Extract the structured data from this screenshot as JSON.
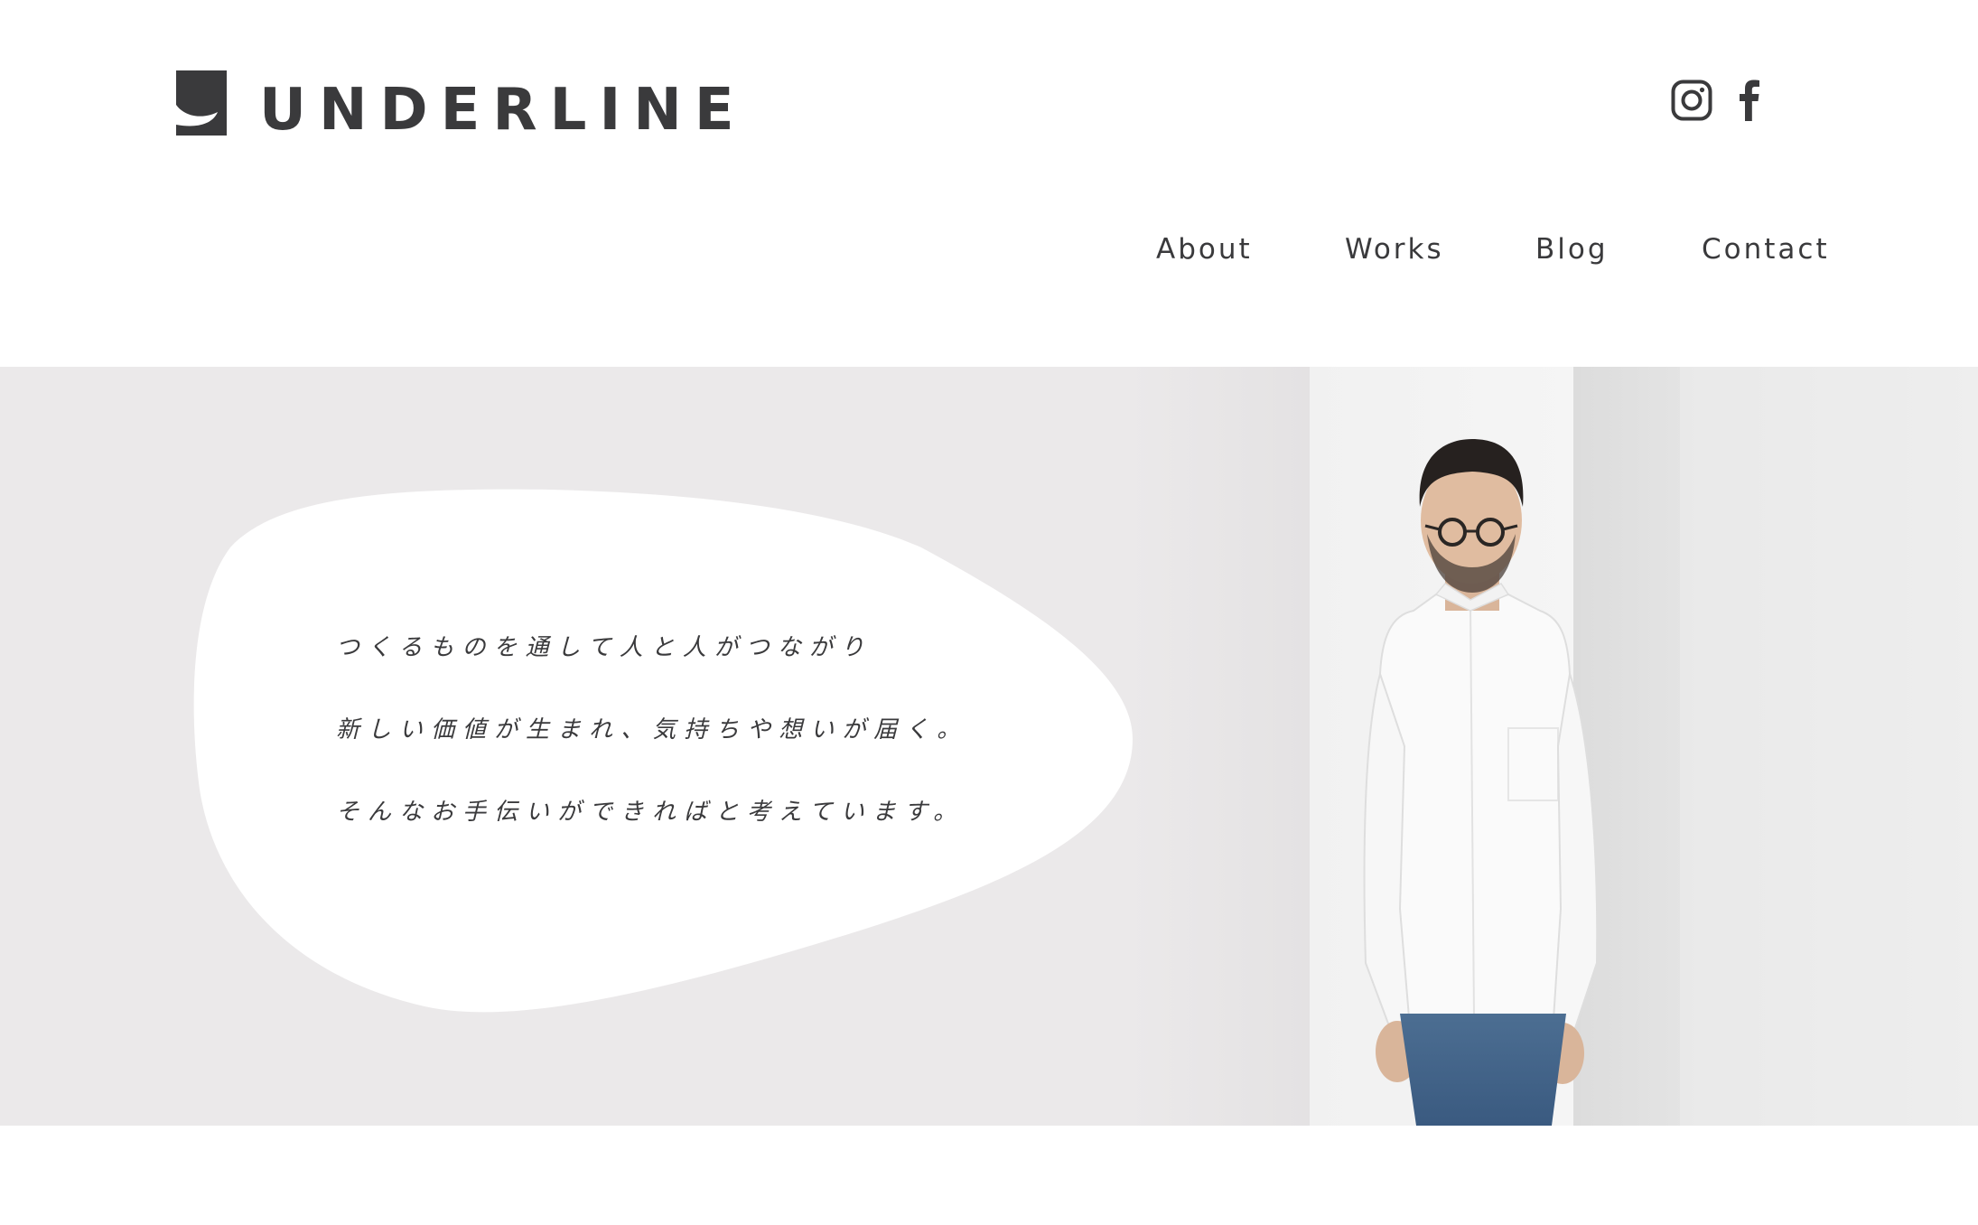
{
  "header": {
    "brand_name": "UNDERLINE"
  },
  "social": {
    "instagram_icon": "instagram-icon",
    "facebook_icon": "facebook-icon"
  },
  "nav": {
    "items": [
      {
        "label": "About"
      },
      {
        "label": "Works"
      },
      {
        "label": "Blog"
      },
      {
        "label": "Contact"
      }
    ]
  },
  "hero": {
    "lines": [
      "つくるものを通して人と人がつながり",
      "新しい価値が生まれ、気持ちや想いが届く。",
      "そんなお手伝いができればと考えています。"
    ]
  },
  "colors": {
    "text": "#3a3a3c",
    "hero_bg": "#ebe9ea",
    "bubble": "#ffffff"
  }
}
